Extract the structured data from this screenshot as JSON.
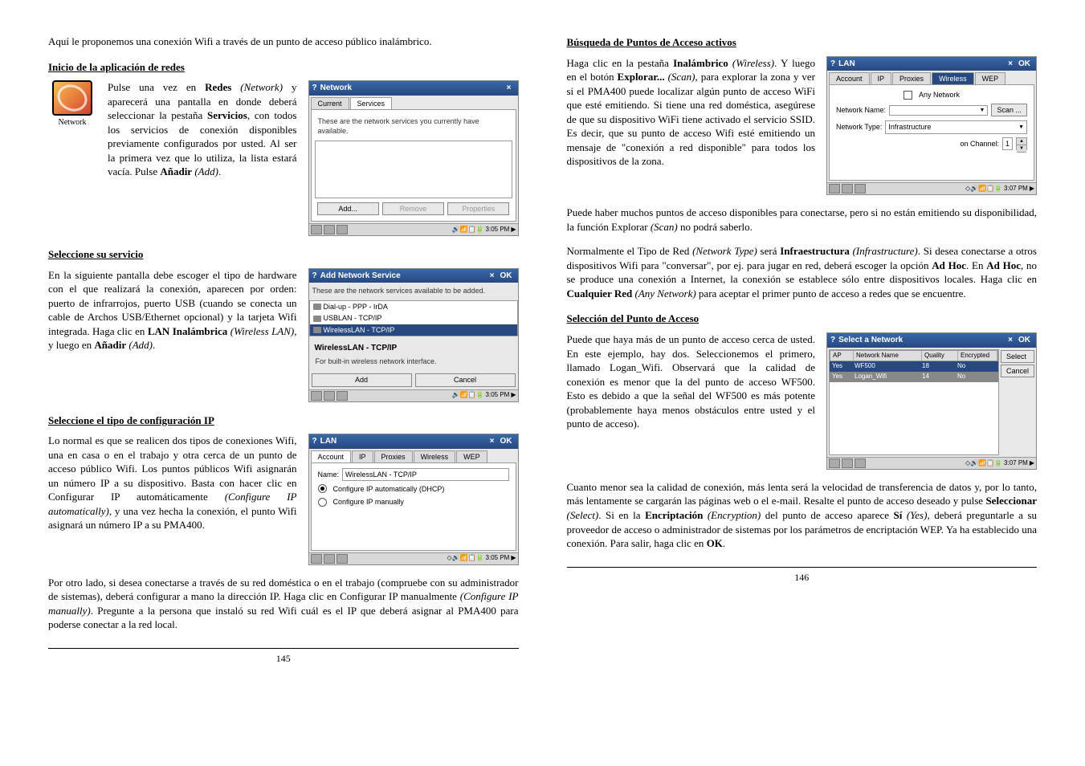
{
  "page_left": {
    "intro": "Aquí le proponemos una conexión Wifi a través de un punto de acceso público inalámbrico.",
    "h1": "Inicio de la aplicación de redes",
    "icon_label": "Network",
    "p1_pre": "Pulse una vez en ",
    "p1_b1": "Redes",
    "p1_i1": " (Network)",
    "p1_mid1": " y aparecerá una pantalla en donde deberá seleccionar la pestaña ",
    "p1_b2": "Servicios",
    "p1_mid2": ", con todos los servicios de conexión disponibles previamente configurados por usted. Al ser la primera vez que lo utiliza, la lista estará vacía. Pulse ",
    "p1_b3": "Añadir",
    "p1_i2": " (Add)",
    "p1_end": ".",
    "h2": "Seleccione su servicio",
    "p2_pre": "En la siguiente pantalla debe escoger el tipo de hardware con el que realizará la conexión, aparecen por orden: puerto de infrarrojos, puerto USB (cuando se conecta un cable de Archos USB/Ethernet opcional) y la tarjeta Wifi integrada. Haga clic en ",
    "p2_b1": "LAN Inalámbrica",
    "p2_i1": " (Wireless LAN)",
    "p2_mid": ", y luego en ",
    "p2_b2": "Añadir",
    "p2_i2": " (Add)",
    "p2_end": ".",
    "h3": "Seleccione el tipo de configuración IP",
    "p3_pre": "Lo normal es que se realicen dos tipos de conexiones Wifi, una en casa o en el trabajo y otra cerca de un punto de acceso público Wifi. Los puntos públicos Wifi asignarán un número IP a su dispositivo. Basta con hacer clic en Configurar IP automáticamente ",
    "p3_i1": "(Configure IP automatically)",
    "p3_mid": ", y una vez hecha la conexión, el punto Wifi asignará un número IP a su PMA400.",
    "p4_pre": "Por otro lado, si desea conectarse a través de su red doméstica o en el trabajo (compruebe con su administrador de sistemas), deberá configurar a mano la dirección IP. Haga clic en Configurar IP manualmente ",
    "p4_i1": "(Configure IP manually)",
    "p4_end": ". Pregunte a la persona que instaló su red Wifi cuál es el IP que deberá asignar al PMA400 para poderse conectar a la red local.",
    "num": "145"
  },
  "page_right": {
    "h1": "Búsqueda de Puntos de Acceso activos",
    "p1_pre": "Haga clic en la pestaña ",
    "p1_b1": "Inalámbrico",
    "p1_i1": " (Wireless)",
    "p1_mid1": ". Y luego en el botón ",
    "p1_b2": "Explorar...",
    "p1_i2": " (Scan)",
    "p1_mid2": ", para explorar la zona y ver si el PMA400 puede localizar algún punto de acceso WiFi que esté emitiendo. Si tiene una red doméstica, asegúrese de que su dispositivo WiFi tiene activado el servicio SSID. Es decir, que su punto de acceso Wifi esté emitiendo un mensaje de \"conexión a red disponible\" para todos los dispositivos de la zona.",
    "p2_pre": "Puede haber muchos puntos de acceso disponibles para conectarse, pero si no están emitiendo su disponibilidad, la función Explorar ",
    "p2_i1": "(Scan)",
    "p2_end": " no podrá saberlo.",
    "p3_pre": "Normalmente el Tipo de Red ",
    "p3_i1": "(Network Type)",
    "p3_mid1": " será ",
    "p3_b1": "Infraestructura",
    "p3_i2": " (Infrastructure)",
    "p3_mid2": ". Si desea conectarse a otros dispositivos Wifi para \"conversar\", por ej. para jugar en red, deberá escoger la opción ",
    "p3_b2": "Ad Hoc",
    "p3_mid3": ". En ",
    "p3_b3": "Ad Hoc",
    "p3_mid4": ", no se produce una conexión a Internet, la conexión se establece sólo entre dispositivos locales. Haga clic en ",
    "p3_b4": "Cualquier Red",
    "p3_i3": " (Any Network)",
    "p3_end": " para aceptar el primer punto de acceso a redes que se encuentre.",
    "h2": "Selección del Punto de Acceso",
    "p4": "Puede que haya más de un punto de acceso cerca de usted. En este ejemplo, hay dos. Seleccionemos el primero, llamado Logan_Wifi. Observará que la calidad de conexión es menor que la del punto de acceso WF500. Esto es debido a que la señal del WF500 es más potente (probablemente haya menos obstáculos entre usted y el punto de acceso).",
    "p5_pre": "Cuanto menor sea la calidad de conexión, más lenta será la velocidad de transferencia de datos y, por lo tanto, más lentamente se cargarán las páginas web o el e-mail. Resalte el punto de acceso deseado y pulse ",
    "p5_b1": "Seleccionar",
    "p5_i1": " (Select)",
    "p5_mid1": ". Si en la ",
    "p5_b2": "Encriptación",
    "p5_i2": " (Encryption)",
    "p5_mid2": " del punto de acceso aparece ",
    "p5_b3": "Sí",
    "p5_i3": " (Yes)",
    "p5_mid3": ", deberá preguntarle a su proveedor de acceso o administrador de sistemas por los parámetros de encriptación WEP. Ya ha establecido una conexión. Para salir, haga clic en ",
    "p5_b4": "OK",
    "p5_end": ".",
    "num": "146"
  },
  "shots": {
    "network": {
      "title": "Network",
      "tab1": "Current",
      "tab2": "Services",
      "msg": "These are the network services you currently have available.",
      "add": "Add...",
      "remove": "Remove",
      "props": "Properties",
      "time": "3:05 PM"
    },
    "addsvc": {
      "title": "Add Network Service",
      "msg": "These are the network services available to be added.",
      "item1": "Dial-up - PPP - IrDA",
      "item2": "USBLAN - TCP/IP",
      "item3": "WirelessLAN - TCP/IP",
      "svc_name": "WirelessLAN - TCP/IP",
      "svc_desc": "For built-in wireless network interface.",
      "add": "Add",
      "cancel": "Cancel",
      "time": "3:05 PM"
    },
    "lan": {
      "title": "LAN",
      "tab_account": "Account",
      "tab_ip": "IP",
      "tab_proxies": "Proxies",
      "tab_wireless": "Wireless",
      "tab_wep": "WEP",
      "name_label": "Name:",
      "name_val": "WirelessLAN - TCP/IP",
      "opt1": "Configure IP automatically (DHCP)",
      "opt2": "Configure IP manually",
      "time": "3:05 PM"
    },
    "lan2": {
      "title": "LAN",
      "any": "Any Network",
      "nn": "Network Name:",
      "scan": "Scan ...",
      "nt": "Network Type:",
      "nt_val": "Infrastructure",
      "ch": "on Channel:",
      "ch_val": "1",
      "time": "3:07 PM"
    },
    "select": {
      "title": "Select a Network",
      "h_ap": "AP",
      "h_name": "Network Name",
      "h_q": "Quality",
      "h_enc": "Encrypted",
      "r1_ap": "Yes",
      "r1_name": "WF500",
      "r1_q": "18",
      "r1_enc": "No",
      "r2_ap": "Yes",
      "r2_name": "Logan_Wifi",
      "r2_q": "14",
      "r2_enc": "No",
      "select": "Select",
      "cancel": "Cancel",
      "time": "3:07 PM"
    }
  }
}
